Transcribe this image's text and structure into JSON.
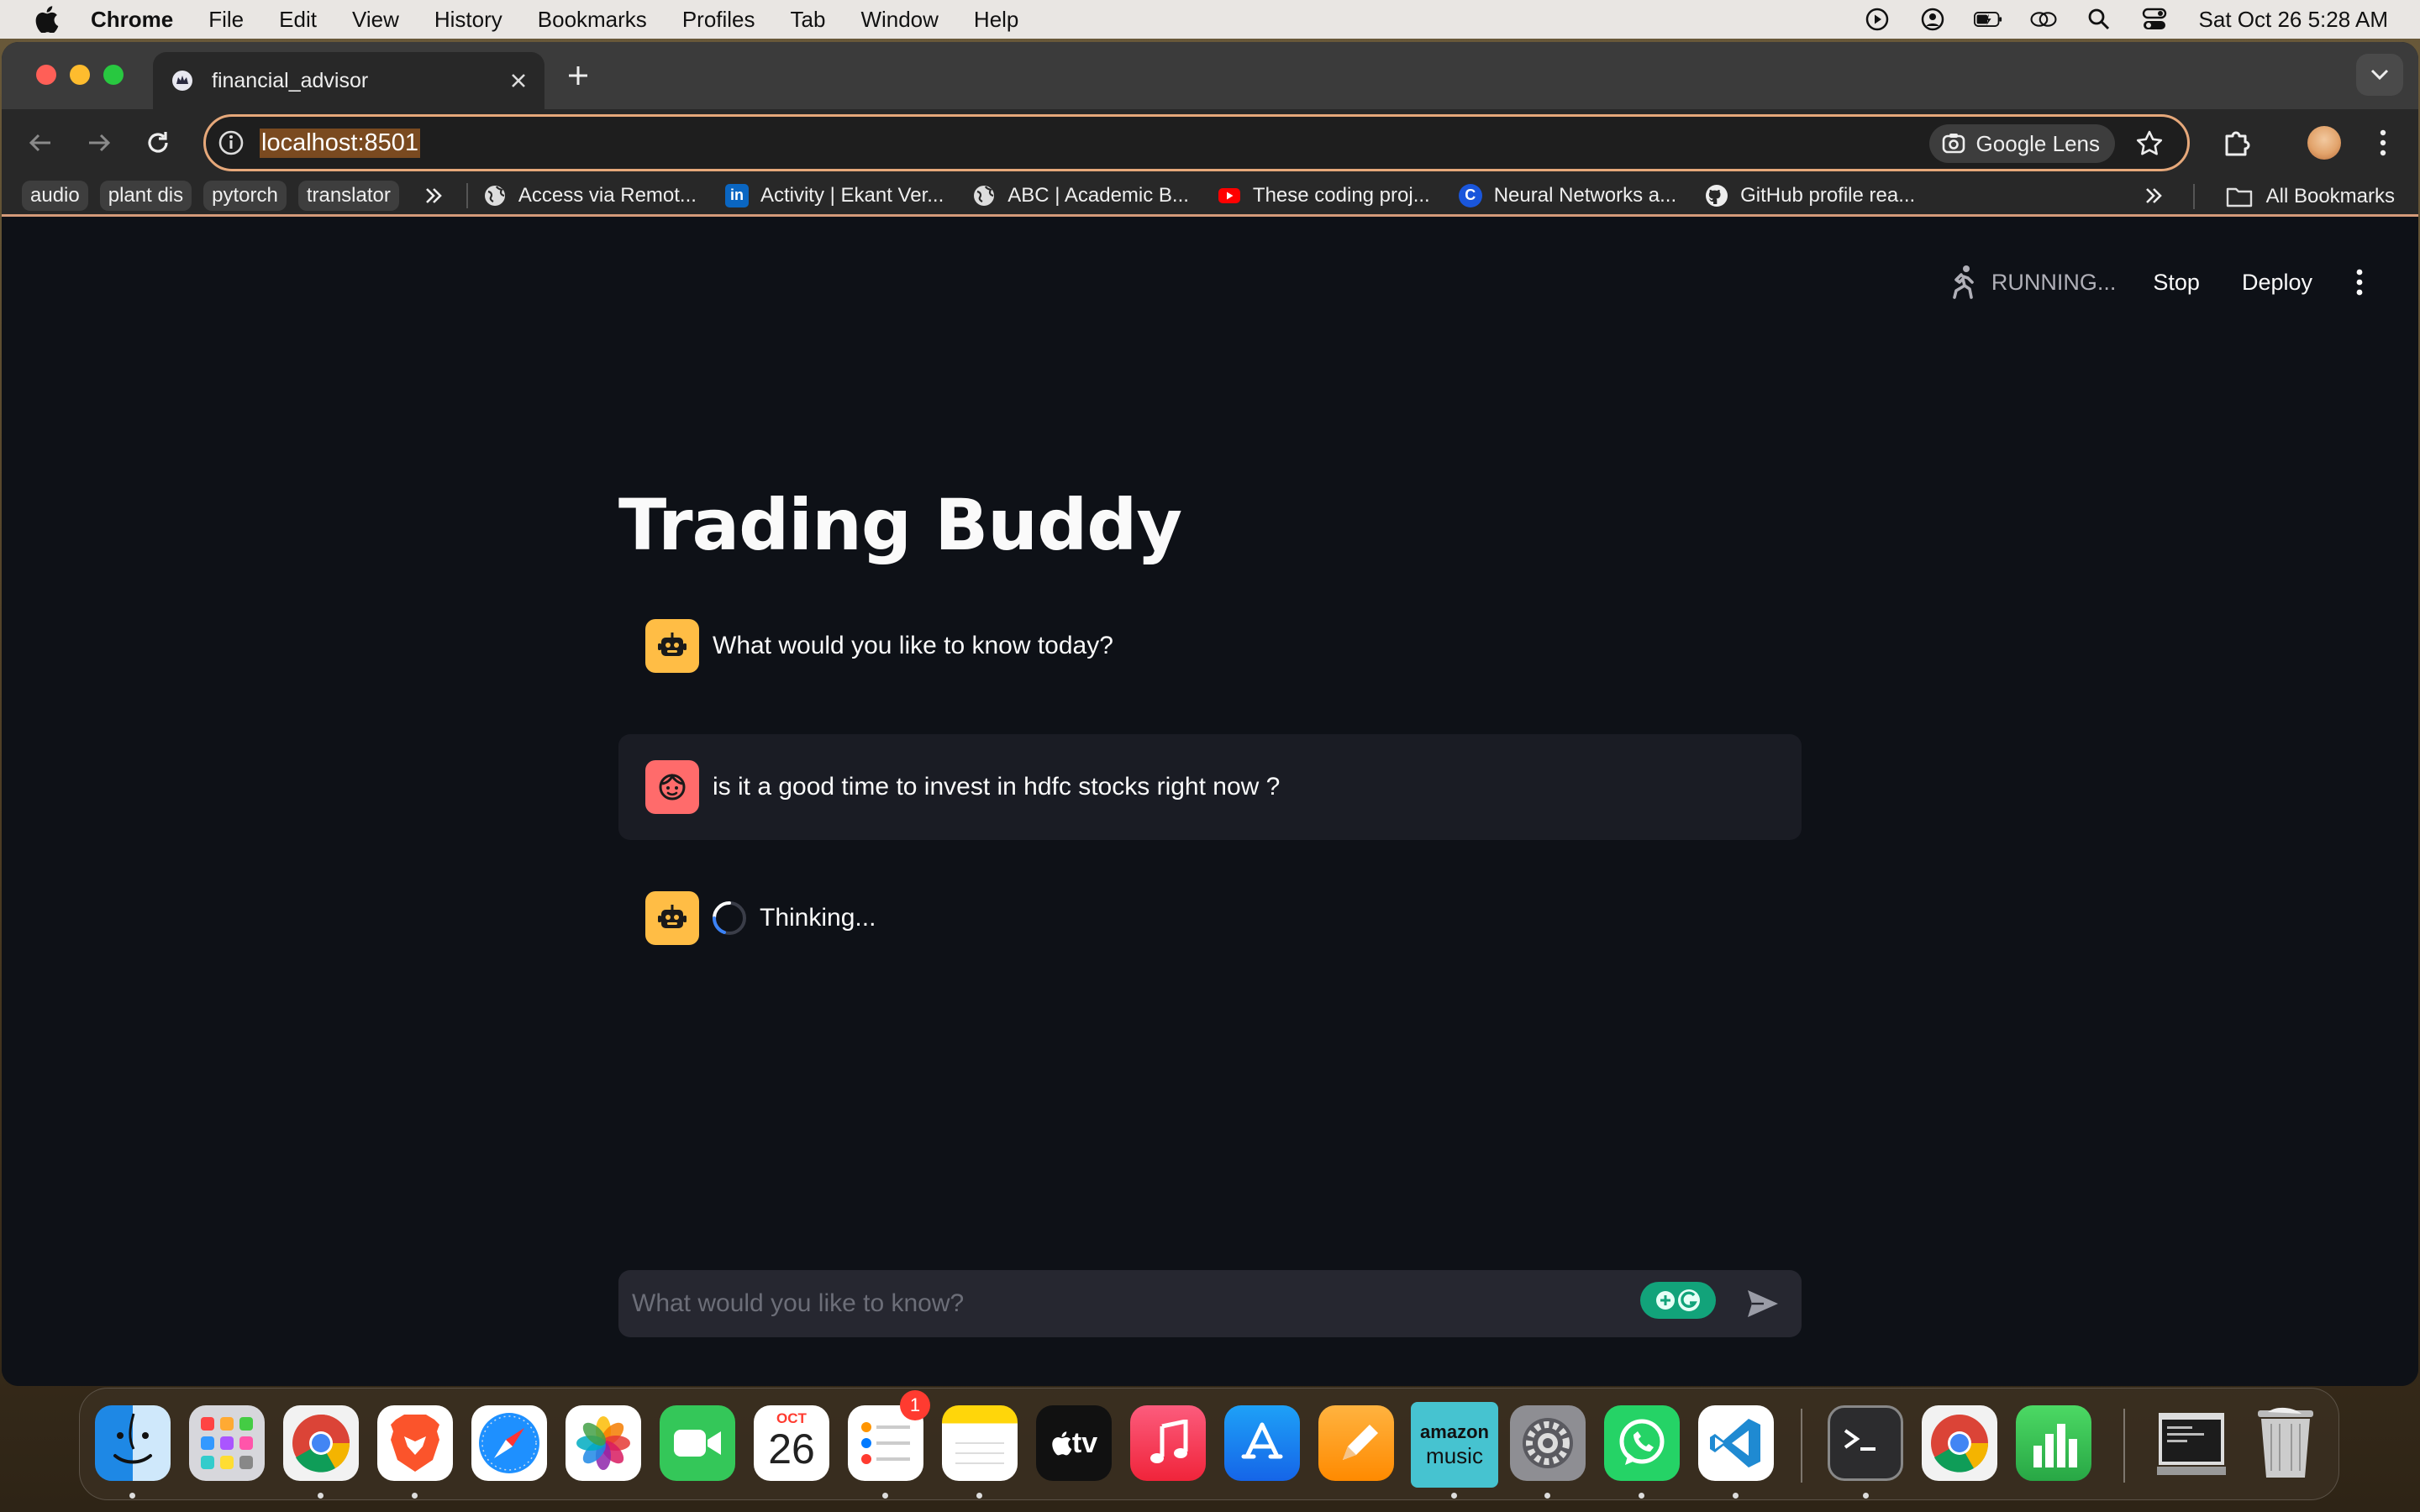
{
  "menubar": {
    "app_name": "Chrome",
    "items": [
      "File",
      "Edit",
      "View",
      "History",
      "Bookmarks",
      "Profiles",
      "Tab",
      "Window",
      "Help"
    ],
    "clock": "Sat Oct 26  5:28 AM"
  },
  "browser": {
    "tab_title": "financial_advisor",
    "url": "localhost:8501",
    "lens_label": "Google Lens",
    "bookmark_chips": [
      "audio",
      "plant dis",
      "pytorch",
      "translator"
    ],
    "bookmarks": [
      {
        "label": "Access via Remot...",
        "icon": "globe-icon"
      },
      {
        "label": "Activity | Ekant Ver...",
        "icon": "linkedin-icon"
      },
      {
        "label": "ABC | Academic B...",
        "icon": "globe-icon"
      },
      {
        "label": "These coding proj...",
        "icon": "youtube-icon"
      },
      {
        "label": "Neural Networks a...",
        "icon": "c-icon"
      },
      {
        "label": "GitHub profile rea...",
        "icon": "github-icon"
      }
    ],
    "all_bookmarks_label": "All Bookmarks"
  },
  "streamlit": {
    "status": "RUNNING...",
    "stop_label": "Stop",
    "deploy_label": "Deploy"
  },
  "page": {
    "title": "Trading Buddy",
    "messages": [
      {
        "role": "assistant",
        "text": "What would you like to know today?"
      },
      {
        "role": "user",
        "text": "is it a good time to invest in hdfc stocks right now ?"
      },
      {
        "role": "assistant",
        "text": "Thinking..."
      }
    ],
    "input_placeholder": "What would you like to know?"
  },
  "dock": {
    "calendar_month": "OCT",
    "calendar_day": "26",
    "reminders_badge": "1",
    "tv_label": "tv",
    "amazon_music_line1": "amazon",
    "amazon_music_line2": "music",
    "apps": [
      "finder-icon",
      "launchpad-icon",
      "chrome-icon",
      "brave-icon",
      "safari-icon",
      "photos-icon",
      "facetime-icon",
      "calendar-icon",
      "reminders-icon",
      "notes-icon",
      "apple-tv-icon",
      "music-icon",
      "app-store-icon",
      "pages-icon",
      "amazon-music-icon",
      "system-settings-icon",
      "whatsapp-icon",
      "vscode-icon",
      "terminal-icon",
      "chrome-icon",
      "numbers-icon",
      "downloads-icon",
      "trash-icon"
    ]
  },
  "colors": {
    "app_bg": "#0e1117",
    "bot_avatar": "#ffbd45",
    "user_avatar": "#ff6b6b",
    "user_bubble": "#1a1c24",
    "input_bg": "#262730",
    "omnibox_border": "#e6a87a"
  }
}
